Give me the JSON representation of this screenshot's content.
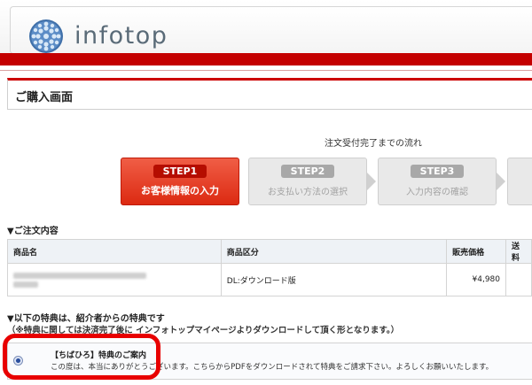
{
  "header": {
    "logo_text": "infotop"
  },
  "page": {
    "title": "ご購入画面"
  },
  "flow": {
    "title": "注文受付完了までの流れ",
    "steps": [
      {
        "badge": "STEP1",
        "label": "お客様情報の入力"
      },
      {
        "badge": "STEP2",
        "label": "お支払い方法の選択"
      },
      {
        "badge": "STEP3",
        "label": "入力内容の確認"
      }
    ]
  },
  "order": {
    "heading": "▼ご注文内容",
    "columns": [
      "商品名",
      "商品区分",
      "販売価格",
      "送料"
    ],
    "row": {
      "category": "DL:ダウンロード版",
      "price": "¥4,980"
    }
  },
  "bonus": {
    "heading": "▼以下の特典は、紹介者からの特典です",
    "note": "（※特典に関しては決済完了後に インフォトップマイページよりダウンロードして頂く形となります。）",
    "title": "【ちばひろ】特典のご案内",
    "text": "この度は、本当にありがとうございます。こちらからPDFをダウンロードされて特典をご請求下さい。よろしくお願いいたします。"
  },
  "colors": {
    "brand_red": "#c40000",
    "step_active": "#dc2a12",
    "highlight": "#e80000"
  }
}
